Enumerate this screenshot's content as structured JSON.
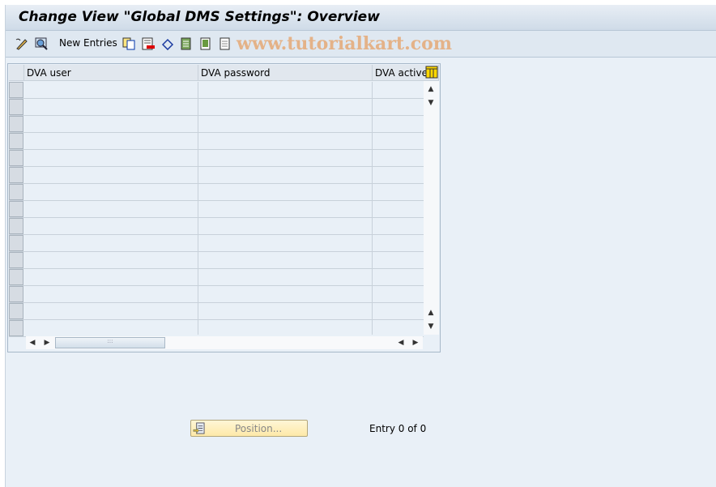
{
  "title": "Change View \"Global DMS Settings\": Overview",
  "toolbar": {
    "new_entries": "New Entries",
    "watermark": "www.tutorialkart.com",
    "icons": [
      "display-change-icon",
      "find-icon",
      "copy-icon",
      "delete-icon",
      "undo-icon",
      "select-all-icon",
      "select-block-icon",
      "deselect-all-icon"
    ]
  },
  "table": {
    "columns": [
      "DVA user",
      "DVA password",
      "DVA active"
    ],
    "rows": 15,
    "column_settings_icon": "table-settings-icon"
  },
  "footer": {
    "position_button": "Position...",
    "entry_text": "Entry 0 of 0"
  }
}
